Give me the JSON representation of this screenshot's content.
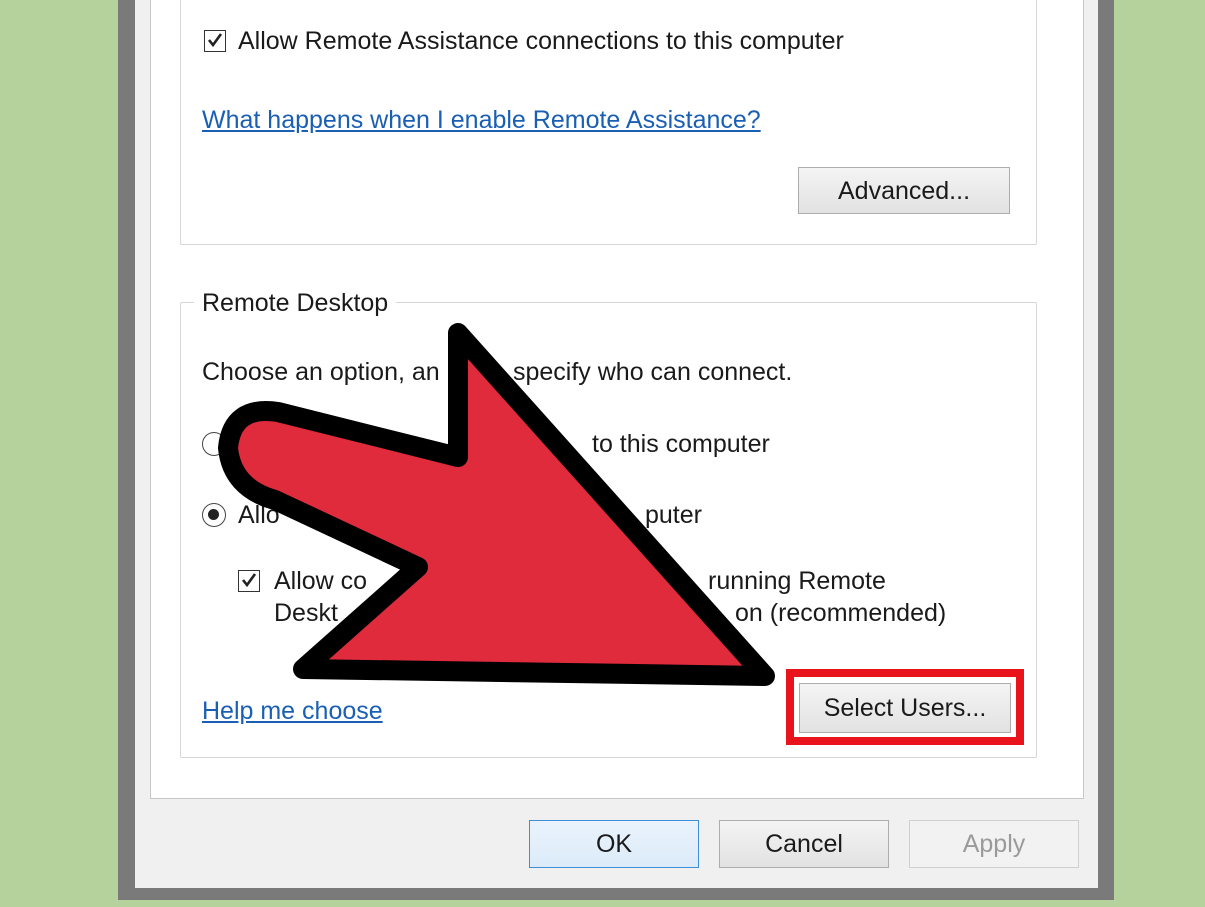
{
  "remote_assistance": {
    "allow_checkbox_label": "Allow Remote Assistance connections to this computer",
    "allow_checked": true,
    "help_link": "What happens when I enable Remote Assistance?",
    "advanced_button": "Advanced..."
  },
  "remote_desktop": {
    "group_title": "Remote Desktop",
    "instruction_visible_start": "Choose an option, an",
    "instruction_visible_end": "specify who can connect.",
    "option1_visible_end": "to this computer",
    "option1_selected": false,
    "option2_visible_end": "puter",
    "option2_selected": true,
    "nla_line1_start": "Allow co",
    "nla_line1_end": "running Remote",
    "nla_line2_start": "Deskt",
    "nla_line2_end": "on (recommended)",
    "nla_checked": true,
    "help_link": "Help me choose",
    "select_users_button": "Select Users..."
  },
  "dialog_buttons": {
    "ok": "OK",
    "cancel": "Cancel",
    "apply": "Apply"
  },
  "overlay": {
    "arrow_color": "#e02b3c",
    "arrow_outline": "#000000",
    "highlight_color": "#e8131b"
  }
}
